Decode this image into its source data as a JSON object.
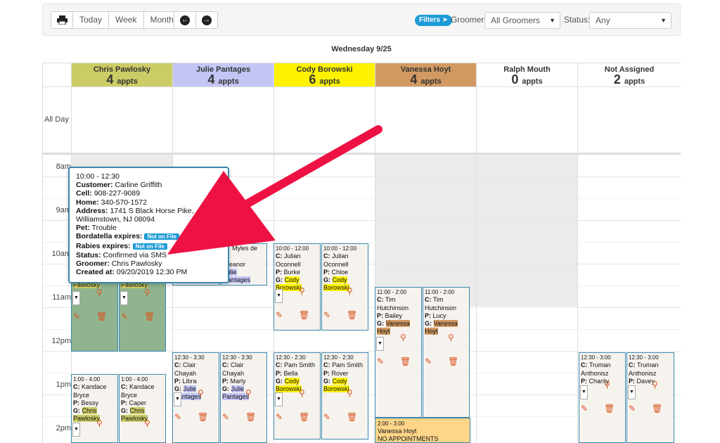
{
  "toolbar": {
    "today": "Today",
    "week": "Week",
    "month": "Month",
    "filters": "Filters",
    "groomer_label": "Groomer:",
    "groomer_value": "All Groomers",
    "status_label": "Status:",
    "status_value": "Any",
    "icons": [
      "print-icon",
      "arrow-left-icon",
      "arrow-right-icon",
      "arrow-right-circle-icon"
    ]
  },
  "day_title": "Wednesday 9/25",
  "allday_label": "All Day",
  "appts_word": "appts",
  "columns": [
    {
      "name": "Chris Pawlosky",
      "count": "4",
      "color": "#cccc66"
    },
    {
      "name": "Julie Pantages",
      "count": "4",
      "color": "#c3c6f5"
    },
    {
      "name": "Cody Borowski",
      "count": "6",
      "color": "#fff200"
    },
    {
      "name": "Vanessa Hoyt",
      "count": "4",
      "color": "#d29a62"
    },
    {
      "name": "Ralph Mouth",
      "count": "0",
      "color": "#ffffff"
    },
    {
      "name": "Not Assigned",
      "count": "2",
      "color": "#ffffff"
    }
  ],
  "times": [
    "8am",
    "9am",
    "10am",
    "11am",
    "12pm",
    "1pm",
    "2pm"
  ],
  "popup": {
    "time": "10:00 - 12:30",
    "customer_label": "Customer:",
    "customer": "Carline Griffith",
    "cell_label": "Cell:",
    "cell": "908-227-9089",
    "home_label": "Home:",
    "home": "340-570-1572",
    "address_label": "Address:",
    "address1": "1741 S Black Horse Pike,",
    "address2": "Williamstown, NJ 08094",
    "pet_label": "Pet:",
    "pet": "Trouble",
    "bordatella_label": "Bordatella expires:",
    "rabies_label": "Rabies expires:",
    "not_on_file": "Not on File",
    "status_label": "Status:",
    "status": "Confirmed via SMS",
    "groomer_label": "Groomer:",
    "groomer": "Chris Pawlosky",
    "created_label": "Created at:",
    "created": "09/20/2019 12:30 PM"
  },
  "appointments": {
    "cody1": {
      "time": "10:00 - 12:00",
      "c": "Julian Oconnell",
      "p": "Burke",
      "g": "Cody Borowski"
    },
    "cody2": {
      "time": "10:00 - 12:00",
      "c": "Julian Oconnell",
      "p": "Chloe",
      "g": "Cody Borowski"
    },
    "cody3": {
      "time": "12:30 - 2:30",
      "c": "Pam Smith",
      "p": "Bella",
      "g": "Cody Borowski"
    },
    "cody4": {
      "time": "12:30 - 2:30",
      "c": "Pam Smith",
      "p": "Rover",
      "g": "Cody Borowski"
    },
    "van1": {
      "time": "11:00 - 2:00",
      "c": "Tim Hutchinson",
      "p": "Bailey",
      "g": "Vanessa Hoyt"
    },
    "van2": {
      "time": "11:00 - 2:00",
      "c": "Tim Hutchinson",
      "p": "Lucy",
      "g": "Vanessa Hoyt"
    },
    "jul1": {
      "time": "12:30 - 3:30",
      "c": "Clair Chayah",
      "p": "Libra",
      "g": "Julie Pantages"
    },
    "jul2": {
      "time": "12:30 - 3:30",
      "c": "Clair Chayah",
      "p": "Marly",
      "g": "Julie Pantages"
    },
    "jul_partial": {
      "c": "Myles de",
      "c2": "s",
      "p": "Eleanor",
      "g": "Julie",
      "g2": "Pantages"
    },
    "chris_top1": "Pawlosky",
    "chris_top2": "Pawlosky",
    "chris1": {
      "time": "1:00 - 4:00",
      "c": "Kandace Bryce",
      "p": "Bessy",
      "g": "Chris Pawlosky"
    },
    "chris2": {
      "time": "1:00 - 4:00",
      "c": "Kandace Bryce",
      "p": "Caper",
      "g": "Chris Pawlosky"
    },
    "na1": {
      "time": "12:30 - 3:00",
      "c": "Truman Anthonisz",
      "p": "Charity"
    },
    "na2": {
      "time": "12:30 - 3:00",
      "c": "Truman Anthonisz",
      "p": "Davey"
    },
    "vanessa_block": {
      "time": "2:00 - 3:00",
      "name": "Vanessa Hoyt",
      "note": "NO APPOINTMENTS"
    }
  },
  "labels": {
    "c": "C:",
    "p": "P:",
    "g": "G:"
  }
}
